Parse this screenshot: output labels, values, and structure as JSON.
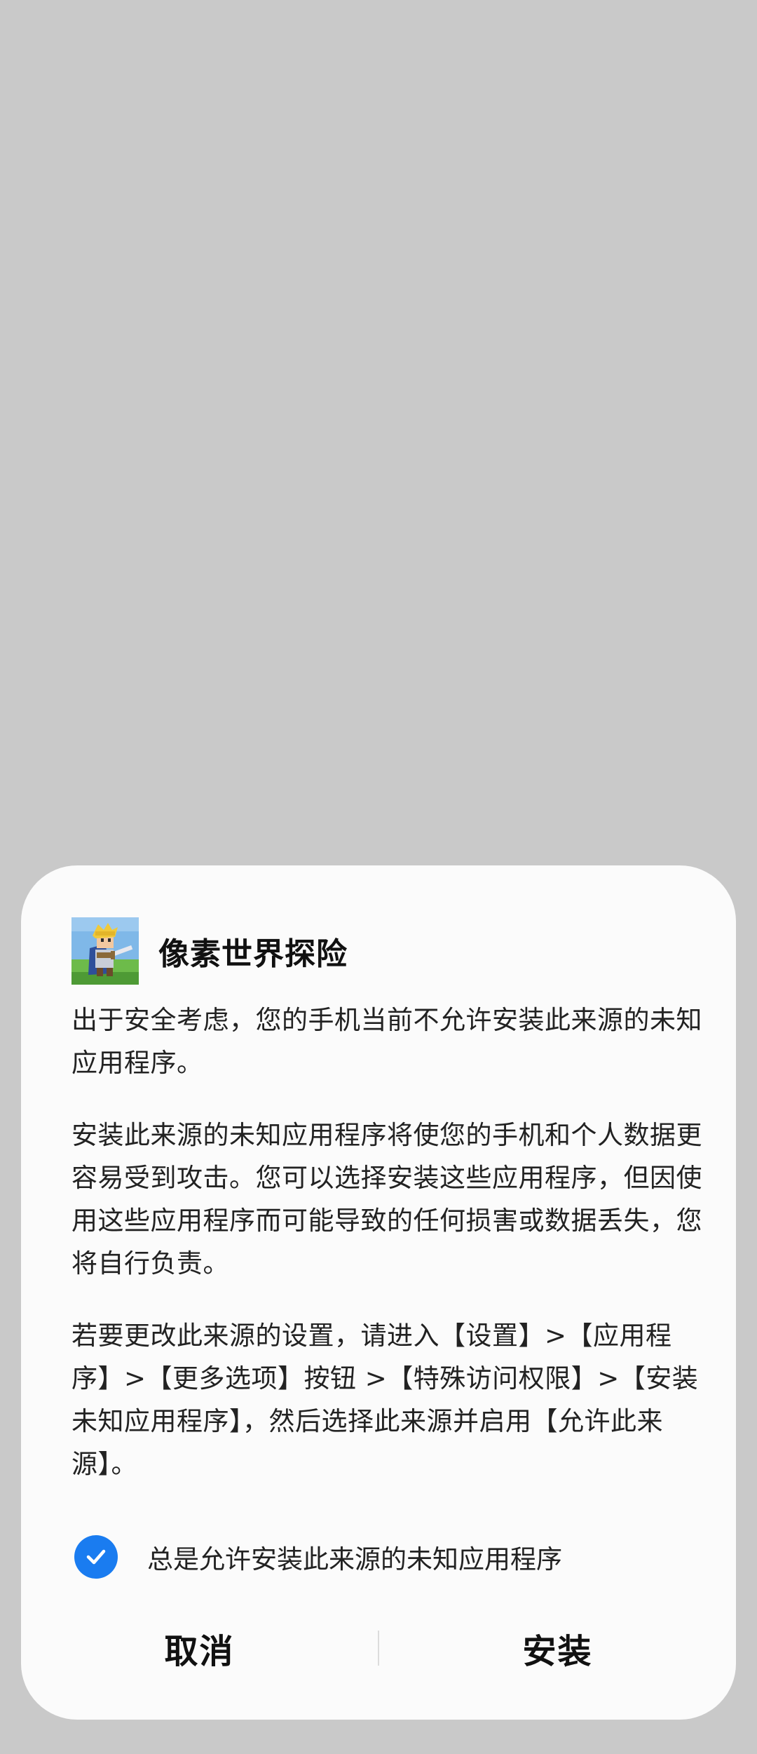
{
  "app": {
    "name": "像素世界探险"
  },
  "dialog": {
    "paragraphs": [
      "出于安全考虑，您的手机当前不允许安装此来源的未知应用程序。",
      "安装此来源的未知应用程序将使您的手机和个人数据更容易受到攻击。您可以选择安装这些应用程序，但因使用这些应用程序而可能导致的任何损害或数据丢失，您将自行负责。",
      "若要更改此来源的设置，请进入【设置】>【应用程序】>【更多选项】按钮 >【特殊访问权限】>【安装未知应用程序】，然后选择此来源并启用【允许此来源】。"
    ],
    "checkbox": {
      "label": "总是允许安装此来源的未知应用程序",
      "checked": true
    },
    "buttons": {
      "cancel": "取消",
      "install": "安装"
    }
  },
  "colors": {
    "backdrop": "#c9c9c9",
    "dialog": "#fbfbfb",
    "accent": "#1a7cf0"
  },
  "icons": {
    "app_icon": "pixel-knight-app-icon",
    "checkbox": "checkmark-icon"
  }
}
